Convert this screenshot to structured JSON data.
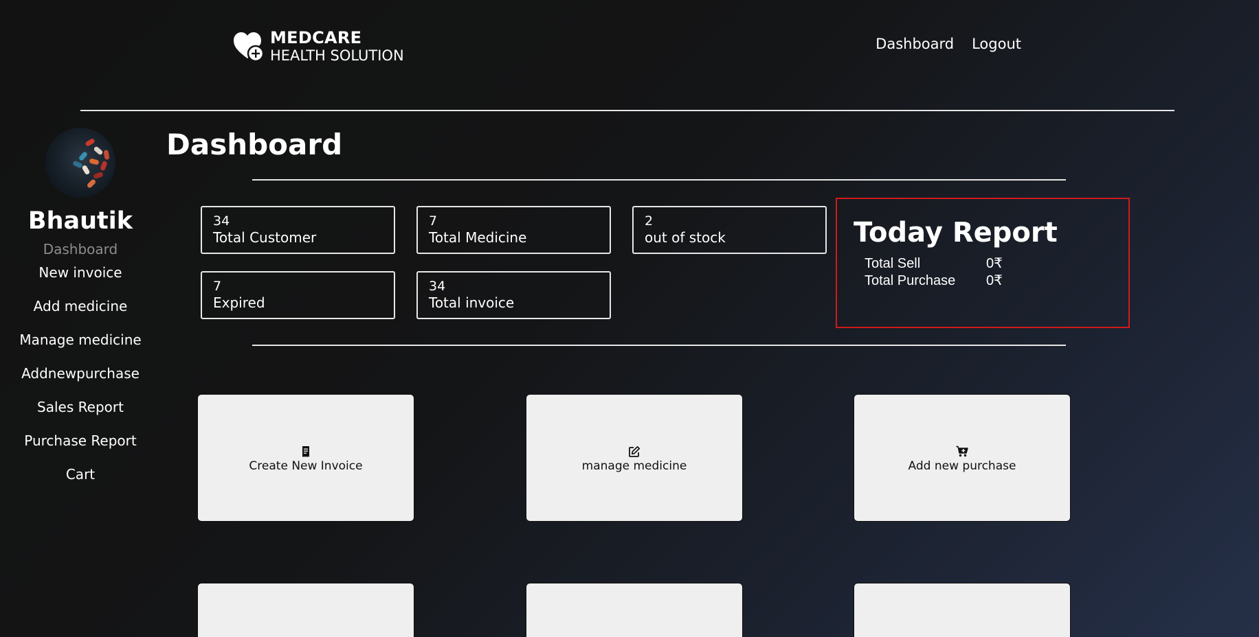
{
  "header": {
    "brand": "MEDCARE",
    "brand_sub": "HEALTH SOLUTION",
    "nav": [
      "Dashboard",
      "Logout"
    ],
    "logo_icon": "heart-plus-icon"
  },
  "sidebar": {
    "user_name": "Bhautik",
    "active_item": "Dashboard",
    "items": [
      "New invoice",
      "Add medicine",
      "Manage medicine",
      "Addnewpurchase",
      "Sales Report",
      "Purchase Report",
      "Cart"
    ]
  },
  "main": {
    "title": "Dashboard",
    "stats": [
      {
        "value": "34",
        "label": "Total Customer"
      },
      {
        "value": "7",
        "label": "Total Medicine"
      },
      {
        "value": "2",
        "label": "out of stock"
      },
      {
        "value": "7",
        "label": "Expired"
      },
      {
        "value": "34",
        "label": "Total invoice"
      }
    ],
    "report": {
      "title": "Today Report",
      "rows": [
        {
          "label": "Total Sell",
          "value": "0₹"
        },
        {
          "label": "Total Purchase",
          "value": "0₹"
        }
      ]
    },
    "tiles": [
      {
        "label": "Create New Invoice",
        "icon": "receipt-icon"
      },
      {
        "label": "manage medicine",
        "icon": "edit-icon"
      },
      {
        "label": "Add new purchase",
        "icon": "cart-plus-icon"
      }
    ]
  },
  "colors": {
    "report_border": "#d11a1a",
    "tile_background": "#efefef",
    "muted_text": "#8d8d8d"
  }
}
